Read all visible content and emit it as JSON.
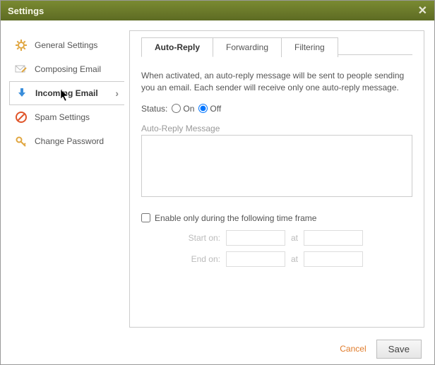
{
  "window": {
    "title": "Settings"
  },
  "sidebar": {
    "items": [
      {
        "label": "General Settings"
      },
      {
        "label": "Composing Email"
      },
      {
        "label": "Incoming Email"
      },
      {
        "label": "Spam Settings"
      },
      {
        "label": "Change Password"
      }
    ]
  },
  "tabs": {
    "auto_reply": "Auto-Reply",
    "forwarding": "Forwarding",
    "filtering": "Filtering"
  },
  "auto_reply": {
    "description": "When activated, an auto-reply message will be sent to people sending you an email. Each sender will receive only one auto-reply message.",
    "status_label": "Status:",
    "on_label": "On",
    "off_label": "Off",
    "status_value": "off",
    "message_label": "Auto-Reply Message",
    "message_value": "",
    "enable_timeframe_label": "Enable only during the following time frame",
    "enable_timeframe_checked": false,
    "start_label": "Start on:",
    "end_label": "End on:",
    "at_label": "at"
  },
  "footer": {
    "cancel": "Cancel",
    "save": "Save"
  }
}
